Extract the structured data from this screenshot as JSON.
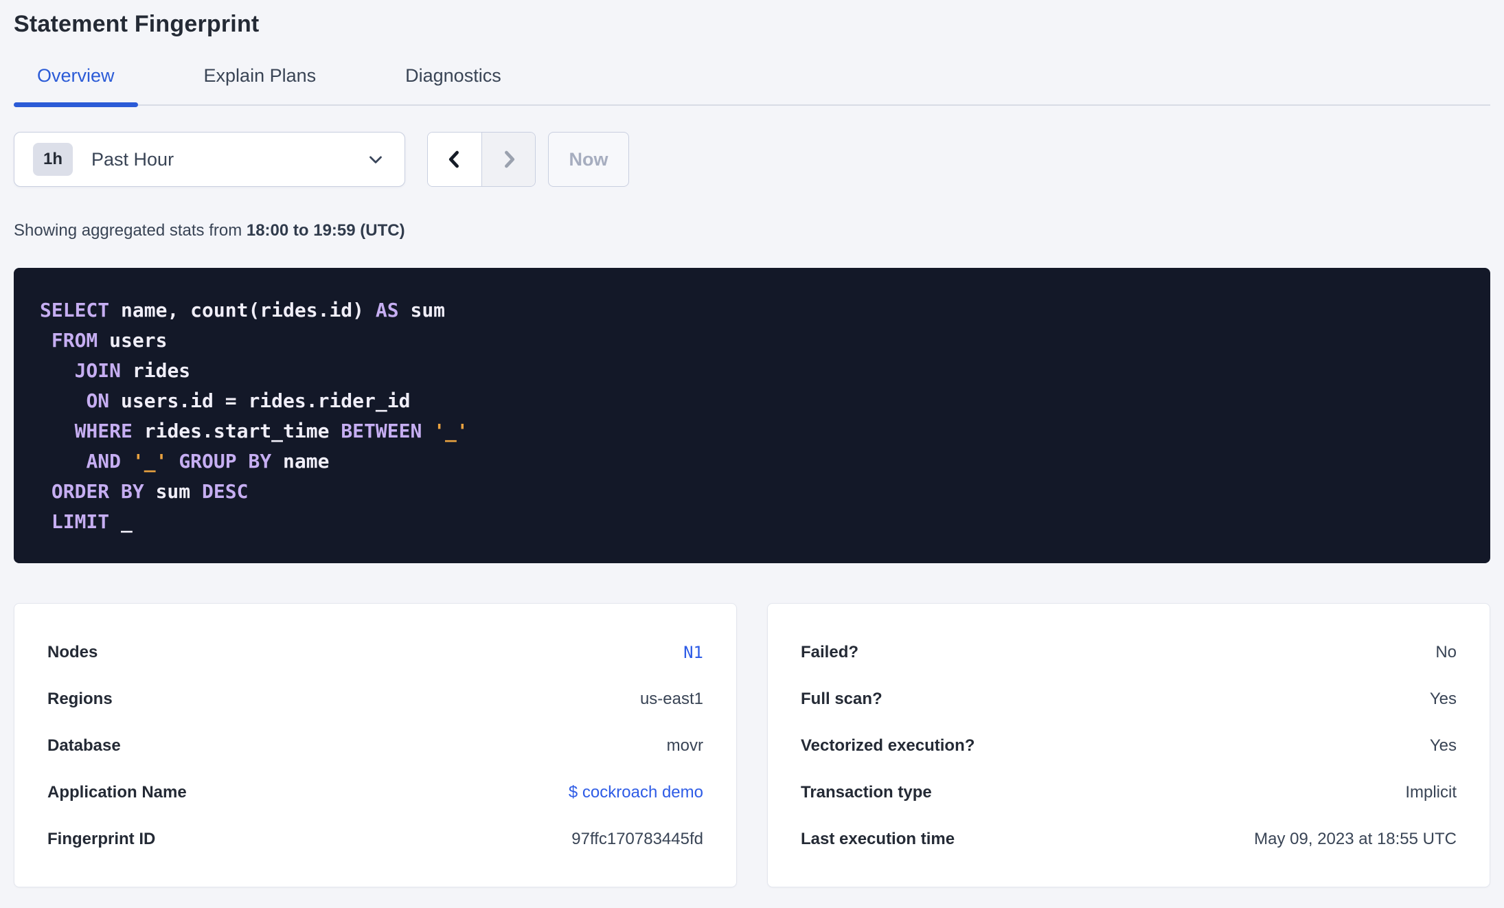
{
  "page_title": "Statement Fingerprint",
  "tabs": [
    {
      "label": "Overview",
      "active": true
    },
    {
      "label": "Explain Plans",
      "active": false
    },
    {
      "label": "Diagnostics",
      "active": false
    }
  ],
  "time_picker": {
    "interval_badge": "1h",
    "selected_option": "Past Hour",
    "prev_enabled": true,
    "next_enabled": false,
    "now_label": "Now"
  },
  "stats_line": {
    "prefix": "Showing aggregated stats from ",
    "range": "18:00 to 19:59 (UTC)"
  },
  "sql": {
    "lines": [
      [
        {
          "t": "SELECT",
          "c": "kw"
        },
        {
          "t": " name, count(rides.id) ",
          "c": "id"
        },
        {
          "t": "AS",
          "c": "kw"
        },
        {
          "t": " sum",
          "c": "id"
        }
      ],
      [
        {
          "t": " ",
          "c": "id"
        },
        {
          "t": "FROM",
          "c": "kw"
        },
        {
          "t": " users",
          "c": "id"
        }
      ],
      [
        {
          "t": "   ",
          "c": "id"
        },
        {
          "t": "JOIN",
          "c": "kw"
        },
        {
          "t": " rides",
          "c": "id"
        }
      ],
      [
        {
          "t": "    ",
          "c": "id"
        },
        {
          "t": "ON",
          "c": "kw"
        },
        {
          "t": " users.id = rides.rider_id",
          "c": "id"
        }
      ],
      [
        {
          "t": "   ",
          "c": "id"
        },
        {
          "t": "WHERE",
          "c": "kw"
        },
        {
          "t": " rides.start_time ",
          "c": "id"
        },
        {
          "t": "BETWEEN",
          "c": "kw"
        },
        {
          "t": " ",
          "c": "id"
        },
        {
          "t": "'_'",
          "c": "str"
        }
      ],
      [
        {
          "t": "    ",
          "c": "id"
        },
        {
          "t": "AND",
          "c": "kw"
        },
        {
          "t": " ",
          "c": "id"
        },
        {
          "t": "'_'",
          "c": "str"
        },
        {
          "t": " ",
          "c": "id"
        },
        {
          "t": "GROUP BY",
          "c": "kw"
        },
        {
          "t": " name",
          "c": "id"
        }
      ],
      [
        {
          "t": " ",
          "c": "id"
        },
        {
          "t": "ORDER BY",
          "c": "kw"
        },
        {
          "t": " sum ",
          "c": "id"
        },
        {
          "t": "DESC",
          "c": "kw"
        }
      ],
      [
        {
          "t": " ",
          "c": "id"
        },
        {
          "t": "LIMIT",
          "c": "kw"
        },
        {
          "t": " _",
          "c": "id"
        }
      ]
    ]
  },
  "details_left": {
    "rows": [
      {
        "label": "Nodes",
        "value": "N1"
      },
      {
        "label": "Regions",
        "value": "us-east1"
      },
      {
        "label": "Database",
        "value": "movr"
      },
      {
        "label": "Application Name",
        "value": "$ cockroach demo"
      },
      {
        "label": "Fingerprint ID",
        "value": "97ffc170783445fd"
      }
    ]
  },
  "details_right": {
    "rows": [
      {
        "label": "Failed?",
        "value": "No"
      },
      {
        "label": "Full scan?",
        "value": "Yes"
      },
      {
        "label": "Vectorized execution?",
        "value": "Yes"
      },
      {
        "label": "Transaction type",
        "value": "Implicit"
      },
      {
        "label": "Last execution time",
        "value": "May 09, 2023 at 18:55 UTC"
      }
    ]
  },
  "colors": {
    "page_bg": "#f4f5f9",
    "text_dark": "#242a35",
    "text_body": "#394455",
    "accent": "#2b5bd7",
    "link": "#2e5ce6",
    "sql_bg": "#131828",
    "sql_kw": "#c6aef2",
    "sql_id": "#f0eef8",
    "sql_str": "#e9a240",
    "badge_bg": "#dcdfe9",
    "control_border": "#c9cfe0",
    "card_border": "#e3e6ee",
    "disabled_text": "#a6adbf"
  }
}
